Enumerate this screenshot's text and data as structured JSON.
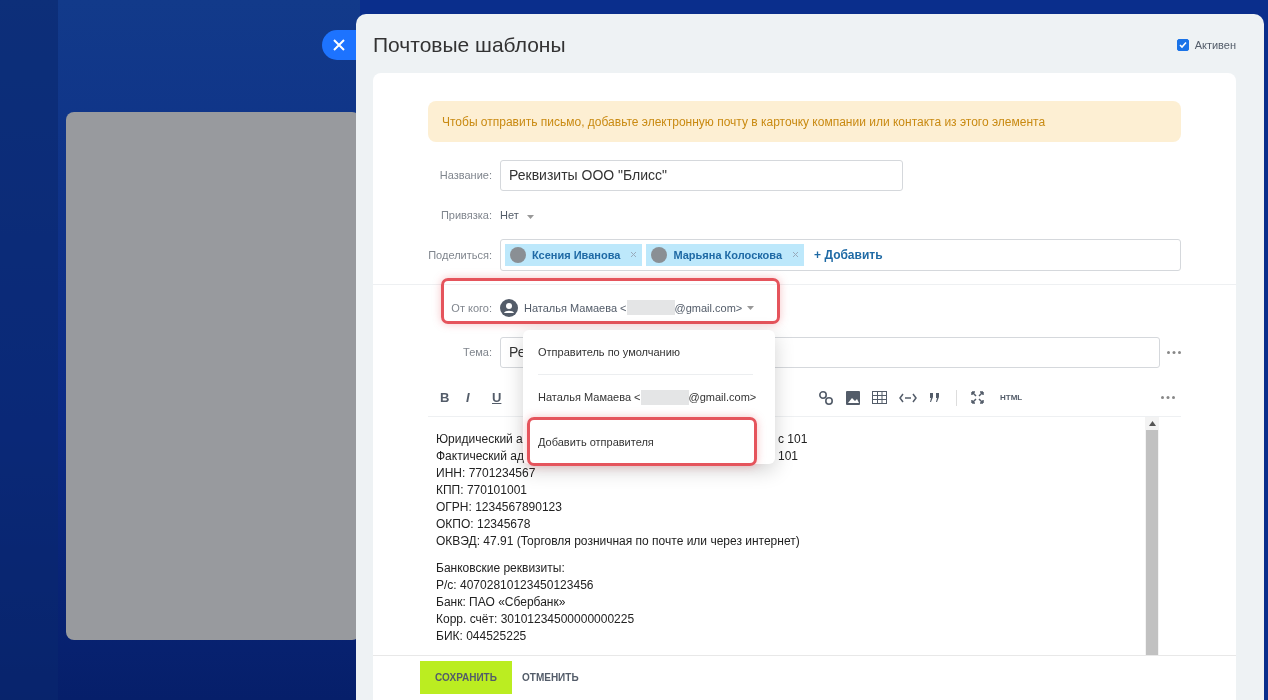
{
  "panel": {
    "title": "Почтовые шаблоны",
    "active": {
      "label": "Активен",
      "checked": true
    }
  },
  "notice": "Чтобы отправить письмо, добавьте электронную почту в карточку компании или контакта из этого элемента",
  "fields": {
    "name": {
      "label": "Название:",
      "value": "Реквизиты ООО \"Блисс\""
    },
    "binding": {
      "label": "Привязка:",
      "value": "Нет"
    },
    "share": {
      "label": "Поделиться:",
      "people": [
        {
          "name": "Ксения Иванова"
        },
        {
          "name": "Марьяна Колоскова"
        }
      ],
      "add": "+ Добавить"
    },
    "from": {
      "label": "От кого:",
      "name": "Наталья Мамаева <",
      "domain": "@gmail.com>",
      "highlighted": true
    },
    "subject": {
      "label": "Тема:",
      "value": "Ре"
    }
  },
  "toolbar": {
    "format": [
      "B",
      "I",
      "U"
    ],
    "html": "HTML"
  },
  "dropdown": [
    {
      "kind": "plain",
      "label": "Отправитель по умолчанию",
      "highlighted": false
    },
    {
      "kind": "address",
      "label": "Наталья Мамаева <",
      "domain": "@gmail.com>",
      "highlighted": false
    },
    {
      "kind": "plain",
      "label": "Добавить отправителя",
      "highlighted": true
    }
  ],
  "body": [
    [
      {
        "text": "Юридический а",
        "tail": "с 101"
      },
      {
        "text": "Фактический ад",
        "tail": "101"
      },
      {
        "text": "ИНН: 7701234567"
      },
      {
        "text": "КПП: 770101001"
      },
      {
        "text": "ОГРН: 1234567890123"
      },
      {
        "text": "ОКПО: 12345678"
      },
      {
        "text": "ОКВЭД: 47.91 (Торговля розничная по почте или через интернет)"
      }
    ],
    [
      {
        "text": "Банковские реквизиты:"
      },
      {
        "text": "Р/с: 40702810123450123456"
      },
      {
        "text": "Банк: ПАО «Сбербанк»"
      },
      {
        "text": "Корр. счёт: 30101234500000000225"
      },
      {
        "text": "БИК: 044525225"
      }
    ]
  ],
  "footer": {
    "save": "СОХРАНИТЬ",
    "cancel": "ОТМЕНИТЬ"
  }
}
